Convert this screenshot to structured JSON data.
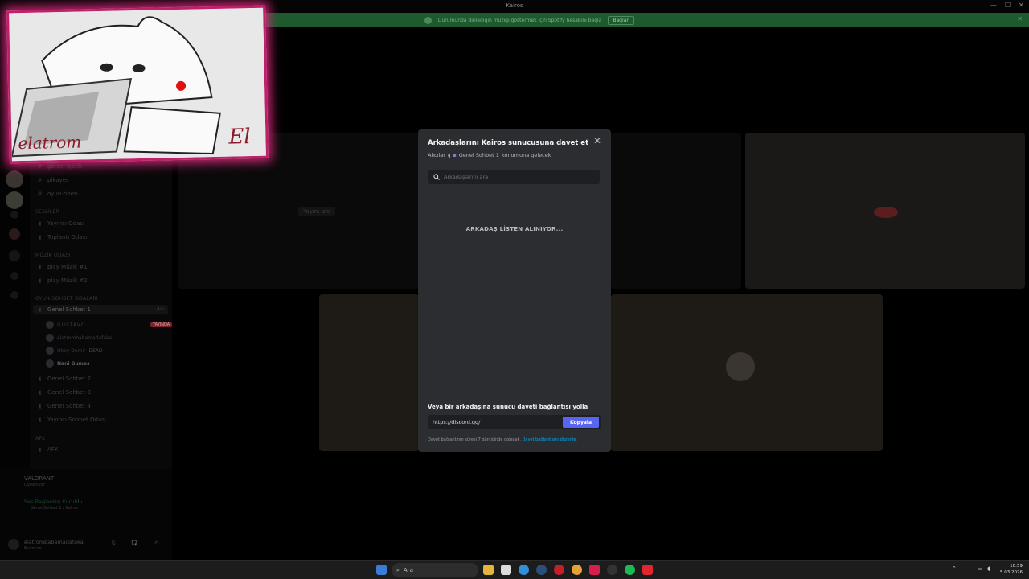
{
  "window": {
    "title": "Kairos",
    "min": "—",
    "max": "☐",
    "close": "✕"
  },
  "banner": {
    "text": "Durumunda dinlediğin müziği göstermek için Spotify hesabını bağla",
    "button": "Bağlan"
  },
  "sidebar": {
    "channels_text": [
      {
        "label": "görsel-içerik",
        "icon": "#"
      },
      {
        "label": "pikayes",
        "icon": "#"
      },
      {
        "label": "oyun-öneri",
        "icon": "#"
      }
    ],
    "cat_voice": "SESLİLER",
    "voice1": [
      {
        "label": "Yayıncı Odası"
      },
      {
        "label": "Toplantı Odası"
      }
    ],
    "cat_music": "MÜZİK ODASI",
    "music": [
      {
        "label": "play Müzik #1"
      },
      {
        "label": "play Müzik #2"
      }
    ],
    "cat_game": "OYUN SOHBET ODALARI",
    "active_channel": "Genel Sohbet 1",
    "active_count": "4/∞",
    "members": [
      {
        "name": "GUSTAVO"
      },
      {
        "name": "elatrombabamadafaka"
      },
      {
        "name": "Okay Demir"
      },
      {
        "name": "Nani Gumes"
      }
    ],
    "live_badge": "YAYINDA",
    "dead_tag": "DEAD",
    "voice2": [
      {
        "label": "Genel Sohbet 2"
      },
      {
        "label": "Genel Sohbet 3"
      },
      {
        "label": "Genel Sohbet 4"
      },
      {
        "label": "Yayıncı Sohbet Odası"
      }
    ],
    "cat_afk": "AFK",
    "afk": "AFK"
  },
  "userpanel": {
    "activity_title": "VALORANT",
    "activity_sub": "Oynanıyor",
    "voice_status": "Ses Bağlantısı Kuruldu",
    "voice_channel": "Genel Sohbet 1 / Kairos",
    "username": "elatrombabamadafaka",
    "user_status": "Evdeyim"
  },
  "main": {
    "watch_stream": "Yayını izle"
  },
  "overlay_art": {
    "signature": "elatrom",
    "initials": "El"
  },
  "modal": {
    "title": "Arkadaşlarını Kairos sunucusuna davet et",
    "recipients_label": "Alıcılar",
    "recipients_channel": "Genel Sohbet 1",
    "recipients_suffix": "konumuna gelecek",
    "search_placeholder": "Arkadaşlarını ara",
    "loading_text": "ARKADAŞ LİSTEN ALINIYOR...",
    "link_header": "Veya bir arkadaşına sunucu daveti bağlantısı yolla",
    "invite_url": "https://discord.gg/",
    "copy_button": "Kopyala",
    "expire_text": "Davet bağlantının süresi 7 gün içinde dolacak.",
    "edit_link": "Davet bağlantısını düzenle."
  },
  "taskbar": {
    "search_label": "Ara",
    "time": "10:59",
    "date": "5.03.2026"
  },
  "colors": {
    "accent": "#5865f2",
    "banner": "#1d5a2e",
    "live": "#7a2129"
  }
}
